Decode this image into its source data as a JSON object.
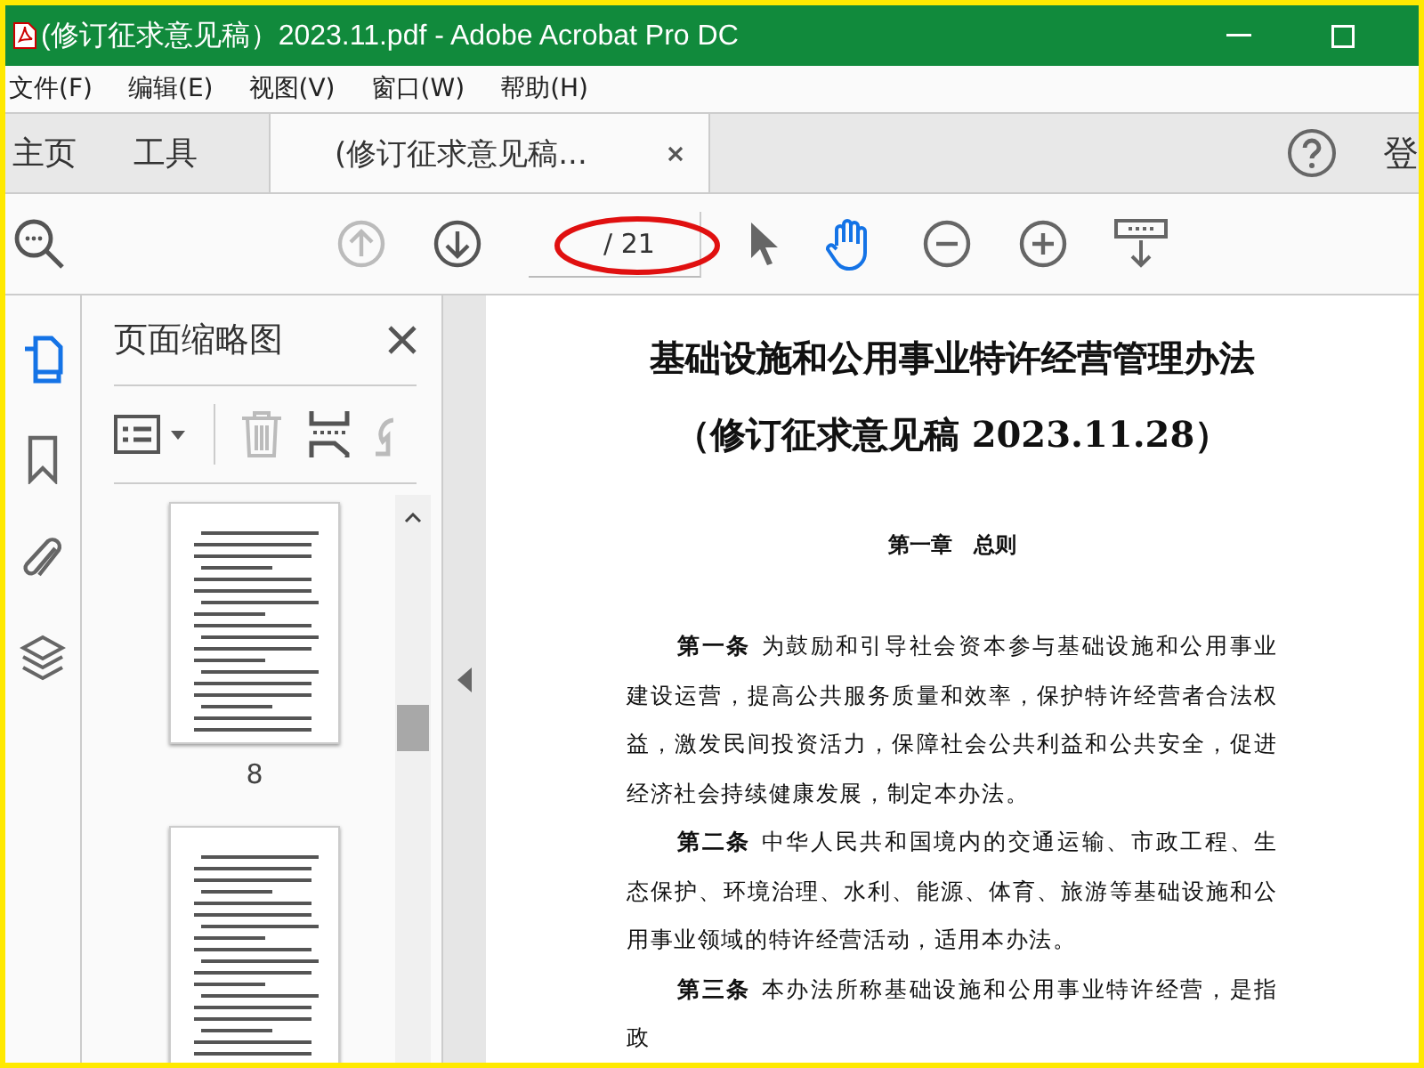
{
  "window": {
    "title": "(修订征求意见稿）2023.11.pdf - Adobe Acrobat Pro DC"
  },
  "menu": [
    "文件(F)",
    "编辑(E)",
    "视图(V)",
    "窗口(W)",
    "帮助(H)"
  ],
  "tabs": [
    {
      "label": "主页",
      "selected": false
    },
    {
      "label": "工具",
      "selected": false
    },
    {
      "label": "(修订征求意见稿...",
      "selected": true,
      "closable": true
    }
  ],
  "account_label": "登",
  "toolbar": {
    "page_field": {
      "total": "/ 21"
    },
    "hand_tool_selected": true
  },
  "sidebar": {
    "tools": [
      {
        "selected": true
      },
      {
        "selected": false
      },
      {
        "selected": false
      },
      {
        "selected": false
      }
    ],
    "panel": {
      "title": "页面缩略图",
      "thumbnails": [
        {
          "kind": "page",
          "label": "8"
        },
        {
          "kind": "page"
        }
      ]
    }
  },
  "document": {
    "title": "基础设施和公用事业特许经营管理办法",
    "subtitle": "（修订征求意见稿 2023.11.28）",
    "chapter": "第一章　总则",
    "paragraphs": [
      "**第一条** 为鼓励和引导社会资本参与基础设施和公用事业建设运营，提高公共服务质量和效率，保护特许经营者合法权益，激发民间投资活力，保障社会公共利益和公共安全，促进经济社会持续健康发展，制定本办法。",
      "**第二条** 中华人民共和国境内的交通运输、市政工程、生态保护、环境治理、水利、能源、体育、旅游等基础设施和公用事业领域的特许经营活动，适用本办法。",
      "**第三条** 本办法所称基础设施和公用事业特许经营，是指政"
    ]
  }
}
